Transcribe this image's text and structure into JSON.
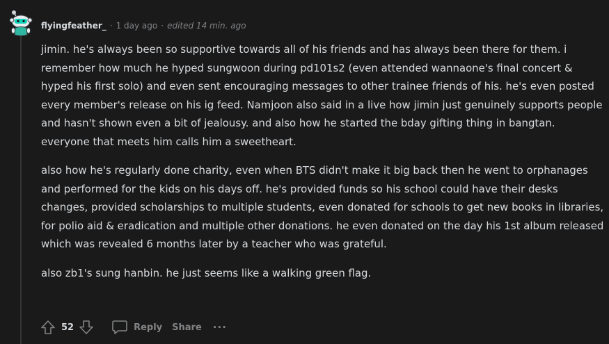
{
  "comment": {
    "username": "flyingfeather_",
    "separator": "·",
    "timestamp": "1 day ago",
    "edited": "edited 14 min. ago",
    "paragraphs": [
      "jimin. he's always been so supportive towards all of his friends and has always been there for them. i remember how much he hyped sungwoon during pd101s2 (even attended wannaone's final concert & hyped his first solo) and even sent encouraging messages to other trainee friends of his. he's even posted every member's release on his ig feed. Namjoon also said in a live how jimin just genuinely supports people and hasn't shown even a bit of jealousy. and also how he started the bday gifting thing in bangtan. everyone that meets him calls him a sweetheart.",
      "also how he's regularly done charity, even when BTS didn't make it big back then he went to orphanages and performed for the kids on his days off. he's provided funds so his school could have their desks changes, provided scholarships to multiple students, even donated for schools to get new books in libraries, for polio aid & eradication and multiple other donations. he even donated on the day his 1st album released which was revealed 6 months later by a teacher who was grateful.",
      "also zb1's sung hanbin. he just seems like a walking green flag."
    ]
  },
  "actions": {
    "vote_count": "52",
    "reply_label": "Reply",
    "share_label": "Share",
    "more_label": "···"
  },
  "icons": {
    "avatar": "snoo-avatar-icon",
    "upvote": "upvote-arrow-icon",
    "downvote": "downvote-arrow-icon",
    "reply": "speech-bubble-icon",
    "more": "ellipsis-icon"
  },
  "colors": {
    "background": "#1a1a1b",
    "text": "#d7dadc",
    "muted": "#818384",
    "avatar_accent": "#0dd3bb"
  }
}
